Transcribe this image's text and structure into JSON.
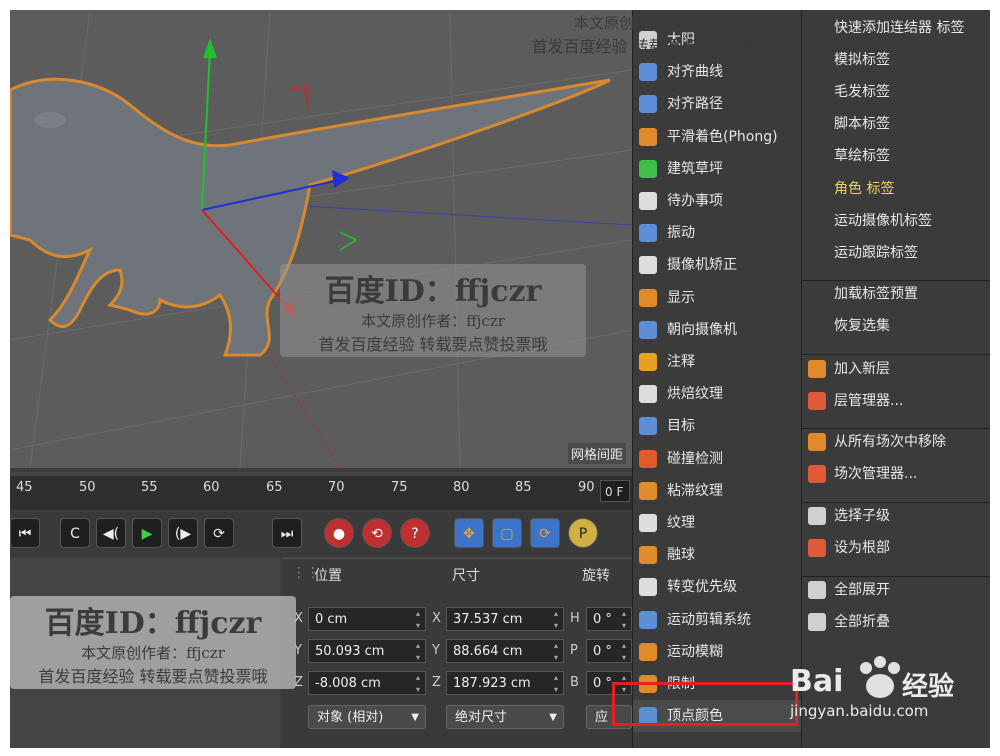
{
  "viewport": {
    "label": "网格间距"
  },
  "timeline": {
    "ticks": [
      "45",
      "50",
      "55",
      "60",
      "65",
      "70",
      "75",
      "80",
      "85",
      "90"
    ],
    "frame_field": "0 F"
  },
  "transport": {
    "buttons": [
      "⏮",
      "C",
      "◀(",
      "▶",
      "(▶",
      "⟳",
      "⏭"
    ],
    "record_buttons": [
      "●",
      "⟲",
      "?"
    ],
    "mode_buttons": [
      "✥",
      "▢",
      "⟳",
      "P"
    ]
  },
  "coords": {
    "head_pos": "位置",
    "head_size": "尺寸",
    "head_rot": "旋转",
    "rows": [
      {
        "axis": "X",
        "pos": "0 cm",
        "size_axis": "X",
        "size": "37.537 cm",
        "rot_axis": "H",
        "rot": "0 °"
      },
      {
        "axis": "Y",
        "pos": "50.093 cm",
        "size_axis": "Y",
        "size": "88.664 cm",
        "rot_axis": "P",
        "rot": "0 °"
      },
      {
        "axis": "Z",
        "pos": "-8.008 cm",
        "size_axis": "Z",
        "size": "187.923 cm",
        "rot_axis": "B",
        "rot": "0 °"
      }
    ],
    "drop_object": "对象 (相对)",
    "drop_size": "绝对尺寸",
    "apply_partial": "应"
  },
  "menu1": {
    "items": [
      {
        "label": "太阳",
        "icon": "sun-icon",
        "color": "#d0d0d0"
      },
      {
        "label": "对齐曲线",
        "icon": "align-curve-icon",
        "color": "#5a8fd8"
      },
      {
        "label": "对齐路径",
        "icon": "align-path-icon",
        "color": "#5a8fd8"
      },
      {
        "label": "平滑着色(Phong)",
        "icon": "phong-icon",
        "color": "#e08a2a"
      },
      {
        "label": "建筑草坪",
        "icon": "grass-icon",
        "color": "#3fbf4a"
      },
      {
        "label": "待办事项",
        "icon": "todo-icon",
        "color": "#dddddd"
      },
      {
        "label": "振动",
        "icon": "vibrate-icon",
        "color": "#5a8fd8"
      },
      {
        "label": "摄像机矫正",
        "icon": "camera-calibrate-icon",
        "color": "#dddddd"
      },
      {
        "label": "显示",
        "icon": "display-icon",
        "color": "#e08a2a"
      },
      {
        "label": "朝向摄像机",
        "icon": "look-at-camera-icon",
        "color": "#5a8fd8"
      },
      {
        "label": "注释",
        "icon": "annotation-icon",
        "color": "#e8a020"
      },
      {
        "label": "烘焙纹理",
        "icon": "bake-texture-icon",
        "color": "#dddddd"
      },
      {
        "label": "目标",
        "icon": "target-icon",
        "color": "#5a8fd8"
      },
      {
        "label": "碰撞检测",
        "icon": "collision-icon",
        "color": "#e05a2a"
      },
      {
        "label": "粘滞纹理",
        "icon": "sticky-texture-icon",
        "color": "#e08a2a"
      },
      {
        "label": "纹理",
        "icon": "texture-icon",
        "color": "#dddddd"
      },
      {
        "label": "融球",
        "icon": "metaball-icon",
        "color": "#e08a2a"
      },
      {
        "label": "转变优先级",
        "icon": "priority-icon",
        "color": "#dddddd"
      },
      {
        "label": "运动剪辑系统",
        "icon": "motion-clip-icon",
        "color": "#5a8fd8"
      },
      {
        "label": "运动模糊",
        "icon": "motion-blur-icon",
        "color": "#e08a2a"
      },
      {
        "label": "限制",
        "icon": "restrict-icon",
        "color": "#e08a2a"
      },
      {
        "label": "顶点颜色",
        "icon": "vertex-color-icon",
        "color": "#5a8fd8"
      }
    ]
  },
  "menu2": {
    "items": [
      {
        "label": "快速添加连结器 标签",
        "icon": "",
        "active": false
      },
      {
        "label": "模拟标签",
        "icon": "",
        "active": false
      },
      {
        "label": "毛发标签",
        "icon": "",
        "active": false
      },
      {
        "label": "脚本标签",
        "icon": "",
        "active": false
      },
      {
        "label": "草绘标签",
        "icon": "",
        "active": false
      },
      {
        "label": "角色 标签",
        "icon": "",
        "active": true
      },
      {
        "label": "运动摄像机标签",
        "icon": "",
        "active": false
      },
      {
        "label": "运动跟踪标签",
        "icon": "",
        "active": false
      },
      {
        "label": "加载标签预置",
        "icon": "",
        "active": false
      },
      {
        "label": "恢复选集",
        "icon": "",
        "active": false
      },
      {
        "label": "加入新层",
        "icon": "add-layer-icon",
        "active": false
      },
      {
        "label": "层管理器...",
        "icon": "layer-manager-icon",
        "active": false
      },
      {
        "label": "从所有场次中移除",
        "icon": "remove-take-icon",
        "active": false
      },
      {
        "label": "场次管理器...",
        "icon": "take-manager-icon",
        "active": false
      },
      {
        "label": "选择子级",
        "icon": "select-children-icon",
        "active": false
      },
      {
        "label": "设为根部",
        "icon": "set-root-icon",
        "active": false
      },
      {
        "label": "全部展开",
        "icon": "expand-all-icon",
        "active": false
      },
      {
        "label": "全部折叠",
        "icon": "collapse-all-icon",
        "active": false
      }
    ]
  },
  "watermarks": {
    "id_text": "百度ID：ffjczr",
    "author_text": "本文原创作者：ffjczr",
    "notice_text": "首发百度经验 转载要点赞投票哦",
    "baidu_logo": "Bai",
    "baidu_jingyan": "经验",
    "baidu_url": "jingyan.baidu.com"
  }
}
